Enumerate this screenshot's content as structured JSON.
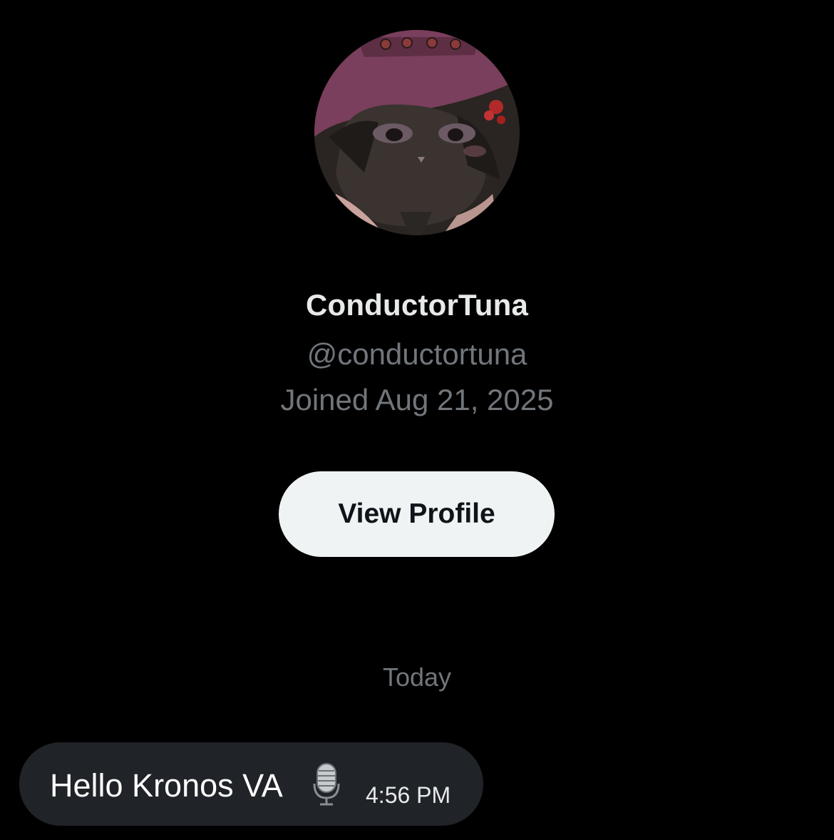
{
  "profile": {
    "display_name": "ConductorTuna",
    "handle": "@conductortuna",
    "joined": "Joined Aug 21, 2025",
    "avatar_icon": "avatar-image",
    "view_profile_label": "View Profile"
  },
  "conversation": {
    "day_divider": "Today",
    "messages": [
      {
        "text": "Hello Kronos VA",
        "icon": "microphone-icon",
        "time": "4:56 PM"
      }
    ]
  },
  "colors": {
    "background": "#000000",
    "primary_text": "#e7e9ea",
    "secondary_text": "#71767b",
    "button_bg": "#eff3f4",
    "button_text": "#0f1419",
    "bubble_bg": "#202327"
  }
}
